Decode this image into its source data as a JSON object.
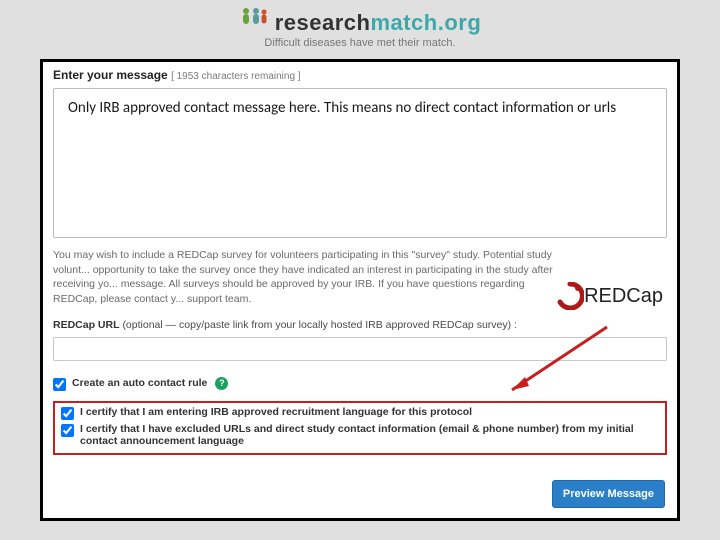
{
  "header": {
    "brand_prefix": "research",
    "brand_suffix": "match.org",
    "tagline": "Difficult diseases have met their match."
  },
  "form": {
    "message_label": "Enter your message",
    "chars_remaining": "[ 1953 characters remaining ]",
    "instruction_text": "Only IRB approved contact message here. This means no direct contact information or urls",
    "helper_paragraph": "You may wish to include a REDCap survey for volunteers participating in this \"survey\" study. Potential study volunt... opportunity to take the survey once they have indicated an interest in participating in the study after receiving yo... message. All surveys should be approved by your IRB. If you have questions regarding REDCap, please contact y... support team.",
    "redcap_url_label": "REDCap URL",
    "redcap_url_hint": "(optional — copy/paste link from your locally hosted IRB approved REDCap survey) :",
    "auto_rule_label": "Create an auto contact rule",
    "cert1_label": "I certify that I am entering IRB approved recruitment language for this protocol",
    "cert2_label": "I certify that I have excluded URLs and direct study contact information (email & phone number) from my initial contact announcement language",
    "preview_button": "Preview Message"
  },
  "redcap_logo_text": "REDCap",
  "colors": {
    "highlight_border": "#c81e1e",
    "button_bg": "#2b7fc9"
  }
}
